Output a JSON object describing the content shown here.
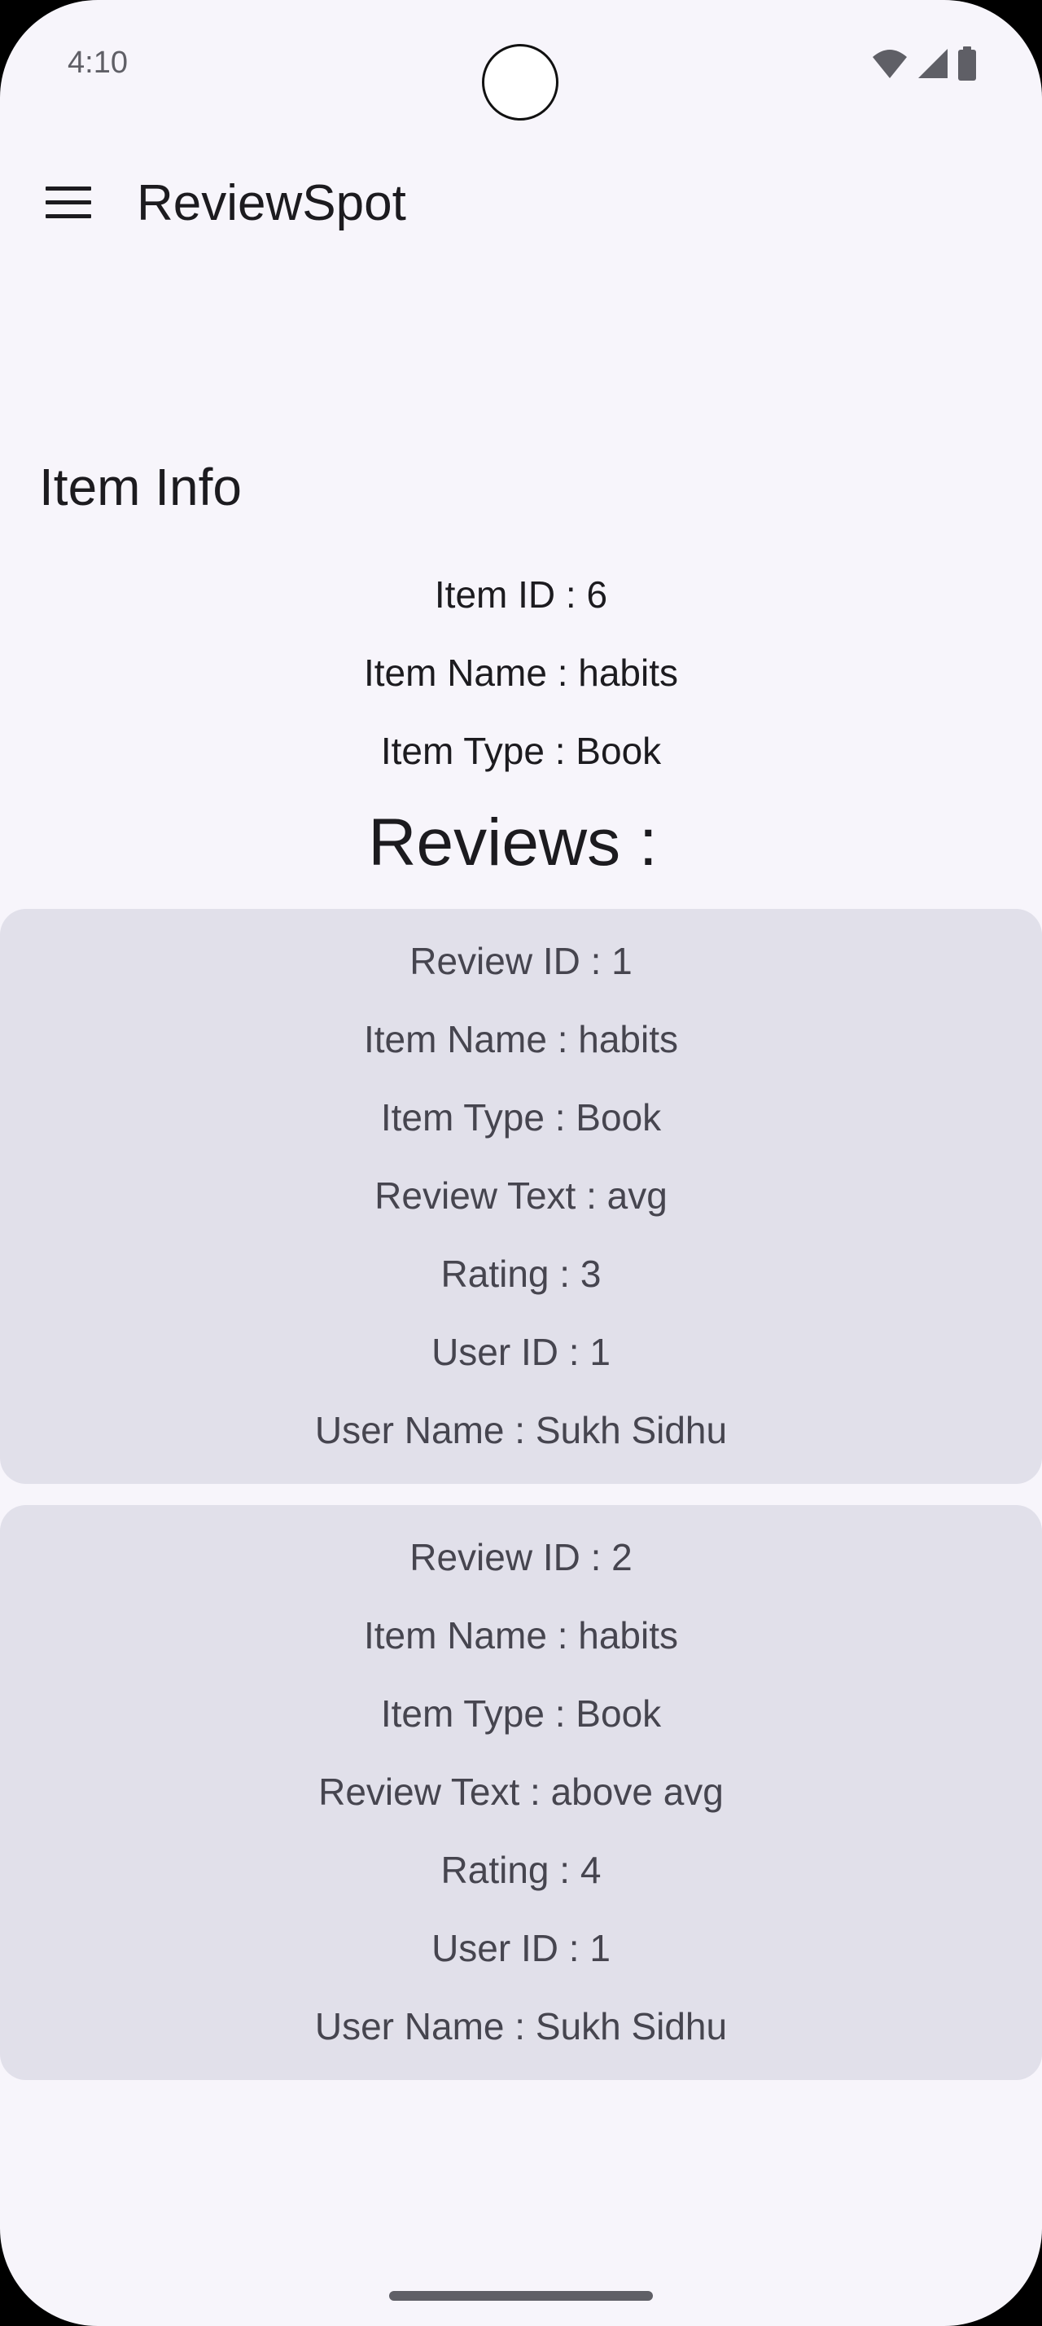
{
  "status_bar": {
    "time": "4:10"
  },
  "app_bar": {
    "title": "ReviewSpot",
    "menu_icon": "hamburger-menu-icon"
  },
  "item_info": {
    "section_title": "Item Info",
    "item_id": "Item ID : 6",
    "item_name": "Item Name : habits",
    "item_type": "Item Type : Book"
  },
  "reviews": {
    "heading": "Reviews :",
    "items": [
      {
        "review_id": "Review ID : 1",
        "item_name": "Item Name : habits",
        "item_type": "Item Type : Book",
        "review_text": "Review Text : avg",
        "rating": "Rating : 3",
        "user_id": "User ID : 1",
        "user_name": "User Name : Sukh Sidhu"
      },
      {
        "review_id": "Review ID : 2",
        "item_name": "Item Name : habits",
        "item_type": "Item Type : Book",
        "review_text": "Review Text : above avg",
        "rating": "Rating : 4",
        "user_id": "User ID : 1",
        "user_name": "User Name : Sukh Sidhu"
      }
    ]
  },
  "colors": {
    "background": "#f7f5fb",
    "card": "#e1e0ea",
    "primary_text": "#1c1b1f",
    "secondary_text": "#46454f"
  }
}
